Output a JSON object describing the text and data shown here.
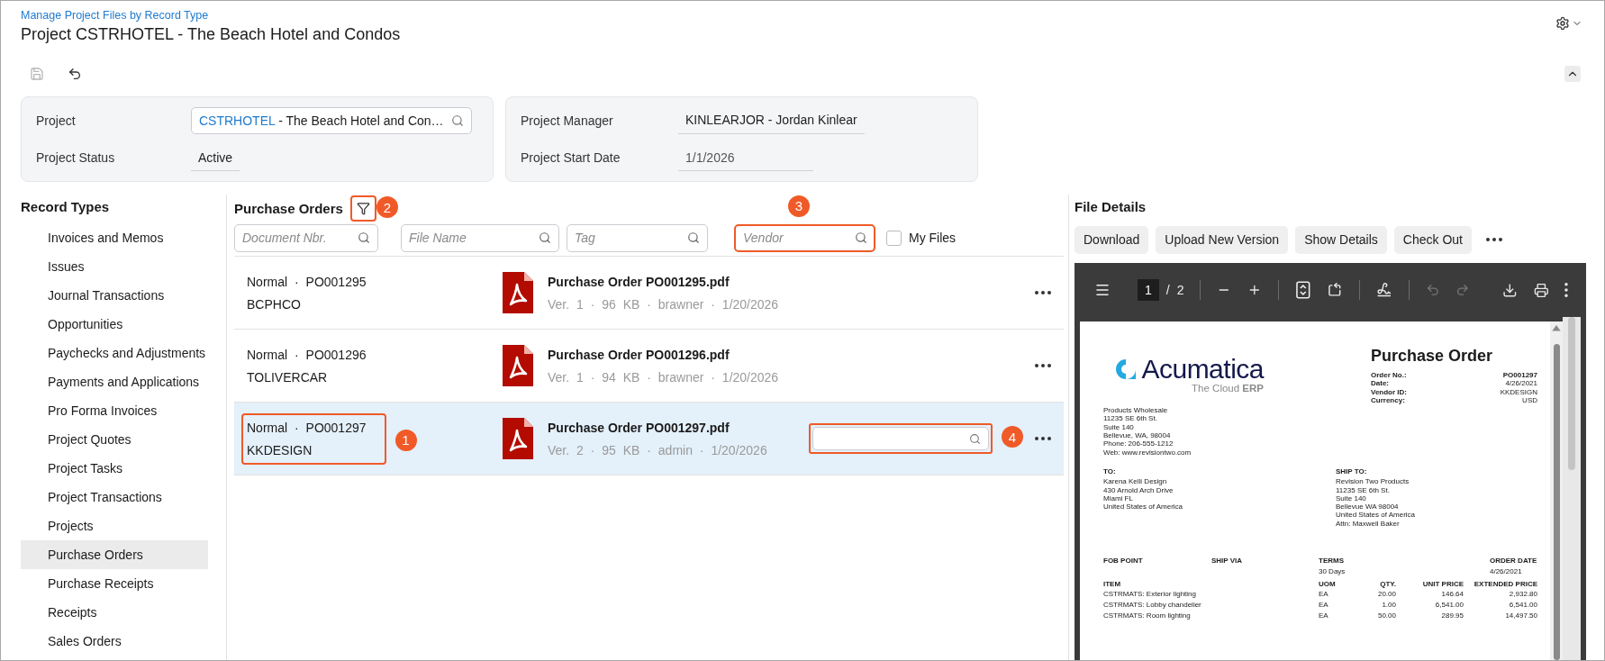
{
  "header": {
    "breadcrumb": "Manage Project Files by Record Type",
    "title": "Project CSTRHOTEL - The Beach Hotel and Condos"
  },
  "toolbar": [
    {
      "kind": "save",
      "disabled": true
    },
    {
      "kind": "undo",
      "disabled": false
    }
  ],
  "summary": [
    {
      "fields": [
        {
          "label": "Project",
          "kind": "lookup",
          "code": "CSTRHOTEL",
          "value": "- The Beach Hotel and Con…"
        },
        {
          "label": "Project Status",
          "kind": "text",
          "value": "Active"
        }
      ]
    },
    {
      "fields": [
        {
          "label": "Project Manager",
          "kind": "text",
          "value": "KINLEARJOR - Jordan Kinlear"
        },
        {
          "label": "Project Start Date",
          "kind": "date",
          "value": "1/1/2026"
        }
      ]
    }
  ],
  "sidebar": {
    "title": "Record Types",
    "items": [
      {
        "label": "Invoices and Memos",
        "selected": false
      },
      {
        "label": "Issues",
        "selected": false
      },
      {
        "label": "Journal Transactions",
        "selected": false
      },
      {
        "label": "Opportunities",
        "selected": false
      },
      {
        "label": "Paychecks and Adjustments",
        "selected": false
      },
      {
        "label": "Payments and Applications",
        "selected": false
      },
      {
        "label": "Pro Forma Invoices",
        "selected": false
      },
      {
        "label": "Project Quotes",
        "selected": false
      },
      {
        "label": "Project Tasks",
        "selected": false
      },
      {
        "label": "Project Transactions",
        "selected": false
      },
      {
        "label": "Projects",
        "selected": false
      },
      {
        "label": "Purchase Orders",
        "selected": true
      },
      {
        "label": "Purchase Receipts",
        "selected": false
      },
      {
        "label": "Receipts",
        "selected": false
      },
      {
        "label": "Sales Orders",
        "selected": false
      }
    ]
  },
  "list": {
    "title": "Purchase Orders",
    "filter_callout": "2",
    "filters": [
      {
        "placeholder": "Document Nbr."
      },
      {
        "placeholder": "File Name"
      },
      {
        "placeholder": "Tag"
      },
      {
        "placeholder": "Vendor",
        "callout": "3"
      }
    ],
    "my_files": {
      "label": "My Files",
      "checked": false
    },
    "rows": [
      {
        "document": "Normal · PO001295",
        "vendor": "BCPHCO",
        "file": "Purchase Order PO001295.pdf",
        "meta": "Ver. 1 · 96 KB · brawner · 1/20/2026",
        "selected": false
      },
      {
        "document": "Normal · PO001296",
        "vendor": "TOLIVERCAR",
        "file": "Purchase Order PO001296.pdf",
        "meta": "Ver. 1 · 94 KB · brawner · 1/20/2026",
        "selected": false
      },
      {
        "document": "Normal · PO001297",
        "vendor": "KKDESIGN",
        "file": "Purchase Order PO001297.pdf",
        "meta": "Ver. 2 · 95 KB · admin · 1/20/2026",
        "selected": true,
        "callout": "1",
        "tag_field": {
          "callout": "4"
        }
      }
    ]
  },
  "details": {
    "title": "File Details",
    "buttons": [
      "Download",
      "Upload New Version",
      "Show Details",
      "Check Out"
    ],
    "viewer": {
      "page": "1",
      "separator": "/",
      "total": "2",
      "history_disabled": true,
      "document": {
        "logo": {
          "name": "Acumatica",
          "tagline": "The Cloud **ERP**"
        },
        "title": "Purchase Order",
        "info": [
          {
            "label": "Order No.:",
            "value": "PO001297",
            "emphasis": true
          },
          {
            "label": "Date:",
            "value": "4/26/2021",
            "emphasis": false
          },
          {
            "label": "Vendor ID:",
            "value": "KKDESIGN",
            "emphasis": false
          },
          {
            "label": "Currency:",
            "value": "USD",
            "emphasis": false
          }
        ],
        "from": [
          "Products Wholesale",
          "11235 SE 6th St.",
          "Suite 140",
          "Bellevue, WA, 98004",
          "Phone: 206-555-1212",
          "Web: www.revisiontwo.com"
        ],
        "to": {
          "label": "TO:",
          "lines": [
            "Karena Kelli Design",
            "430 Arnold Arch Drive",
            "Miami FL",
            "United States of America"
          ]
        },
        "ship_to": {
          "label": "SHIP TO:",
          "lines": [
            "Revision Two Products",
            "11235 SE 6th St.",
            "Suite 140",
            "Bellevue WA 98004",
            "United States of America",
            "Attn: Maxwell Baker"
          ]
        },
        "terms": [
          {
            "label": "FOB POINT"
          },
          {
            "label": "SHIP VIA"
          },
          {
            "label": "TERMS",
            "value": "30 Days"
          },
          {
            "label": "ORDER DATE",
            "value": "4/26/2021"
          }
        ],
        "columns": [
          "ITEM",
          "UOM",
          "QTY.",
          "UNIT PRICE",
          "EXTENDED PRICE"
        ],
        "items": [
          [
            "CSTRMATS: Exterior lighting",
            "EA",
            "20.00",
            "146.64",
            "2,932.80"
          ],
          [
            "CSTRMATS: Lobby chandelier",
            "EA",
            "1.00",
            "6,541.00",
            "6,541.00"
          ],
          [
            "CSTRMATS: Room lighting",
            "EA",
            "50.00",
            "289.95",
            "14,497.50"
          ]
        ]
      }
    }
  }
}
